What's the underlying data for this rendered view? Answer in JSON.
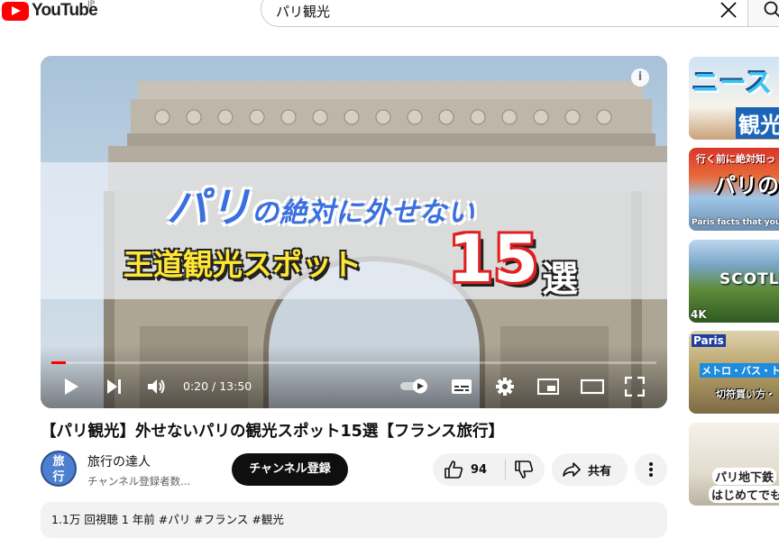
{
  "header": {
    "logo_text": "YouTube",
    "region": "JP",
    "search_value": "パリ観光",
    "icons": [
      "clear-icon",
      "search-icon"
    ]
  },
  "player": {
    "thumb_line1_main": "パリ",
    "thumb_line1_rest": "の絶対に外せない",
    "thumb_line2": "王道観光スポット",
    "thumb_num": "15",
    "thumb_sen": "選",
    "info": "i",
    "time": "0:20 / 13:50",
    "progress_fraction": 0.024,
    "icons": [
      "play-icon",
      "next-icon",
      "volume-icon",
      "autoplay-toggle",
      "subtitles-icon",
      "settings-icon",
      "miniplayer-icon",
      "theater-icon",
      "fullscreen-icon"
    ]
  },
  "video": {
    "title": "【パリ観光】外せないパリの観光スポット15選【フランス旅行】",
    "channel_name": "旅行の達人",
    "subscribers": "チャンネル登録者数...",
    "avatar_text_top": "旅",
    "avatar_text_bottom": "行",
    "subscribe_label": "チャンネル登録",
    "like_count": "94",
    "share_label": "共有",
    "description_snippet": "1.1万 回視聴 1 年前  #パリ #フランス #観光"
  },
  "sidebar": {
    "thumbs": [
      {
        "text": "ニース",
        "sub": "観光",
        "bg": "#e9f1fb"
      },
      {
        "text": "行く前に絶対知っ",
        "sub": "パリの",
        "caption": "Paris facts that you m",
        "bg": "#d83a2c"
      },
      {
        "text": "SCOTLA",
        "badge": "4K",
        "bg": "#5f8c3b"
      },
      {
        "text": "Paris",
        "sub": "切符買い方・",
        "caption": "メトロ・バス・ト",
        "bg": "#b8a36a"
      },
      {
        "text": "パリ地下鉄",
        "sub": "はじめてでも",
        "bg": "#eae6dc"
      }
    ]
  },
  "colors": {
    "accent": "#ff0000",
    "brand_dark": "#0f0f0f",
    "chip": "#f2f2f2"
  }
}
